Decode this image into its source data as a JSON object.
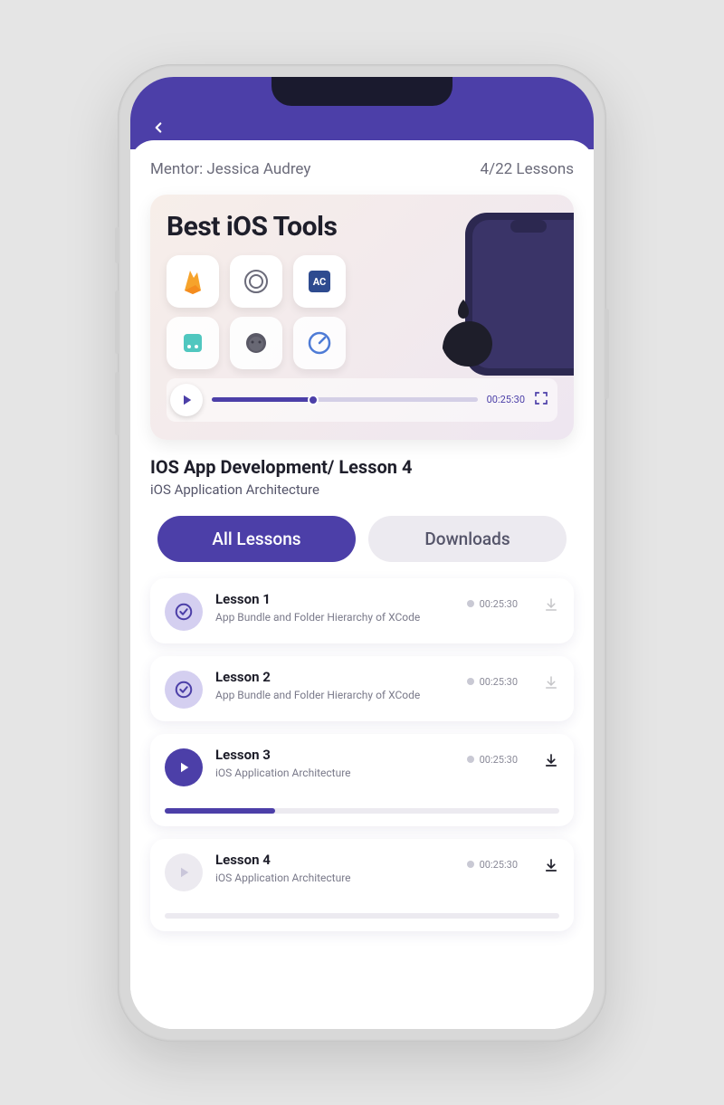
{
  "meta": {
    "mentor_label": "Mentor: Jessica Audrey",
    "progress_label": "4/22 Lessons"
  },
  "video": {
    "title": "Best iOS Tools",
    "time": "00:25:30"
  },
  "course": {
    "title": "IOS App Development/ Lesson 4",
    "subtitle": "iOS Application Architecture"
  },
  "tabs": {
    "all": "All Lessons",
    "downloads": "Downloads"
  },
  "lessons": [
    {
      "title": "Lesson 1",
      "desc": "App Bundle and Folder Hierarchy of XCode",
      "time": "00:25:30",
      "status": "done"
    },
    {
      "title": "Lesson 2",
      "desc": "App Bundle and Folder Hierarchy of XCode",
      "time": "00:25:30",
      "status": "done"
    },
    {
      "title": "Lesson 3",
      "desc": "iOS Application Architecture",
      "time": "00:25:30",
      "status": "playing"
    },
    {
      "title": "Lesson 4",
      "desc": "iOS Application Architecture",
      "time": "00:25:30",
      "status": "idle"
    }
  ]
}
